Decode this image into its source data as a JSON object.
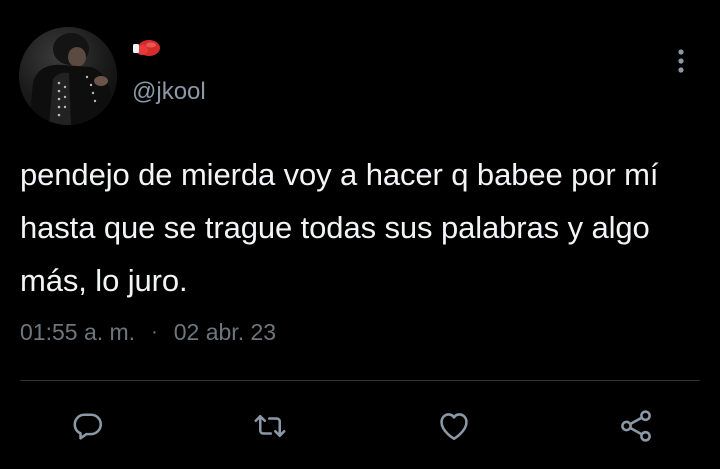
{
  "tweet": {
    "display_name_icon": "boxing-glove-icon",
    "handle": "@jkool",
    "text": "pendejo de mierda voy a hacer q babee por mí hasta que se trague todas sus palabras y algo más, lo juro.",
    "time": "01:55 a. m.",
    "separator": "·",
    "date": "02 abr. 23"
  },
  "actions": {
    "reply_icon": "reply-icon",
    "retweet_icon": "retweet-icon",
    "like_icon": "heart-icon",
    "share_icon": "share-icon",
    "more_icon": "more-vertical-icon"
  },
  "colors": {
    "background": "#000000",
    "text": "#f2f4f5",
    "secondary": "#6e767d",
    "handle": "#8b98a5",
    "divider": "#2f3336",
    "emoji_red": "#d62b2b"
  }
}
